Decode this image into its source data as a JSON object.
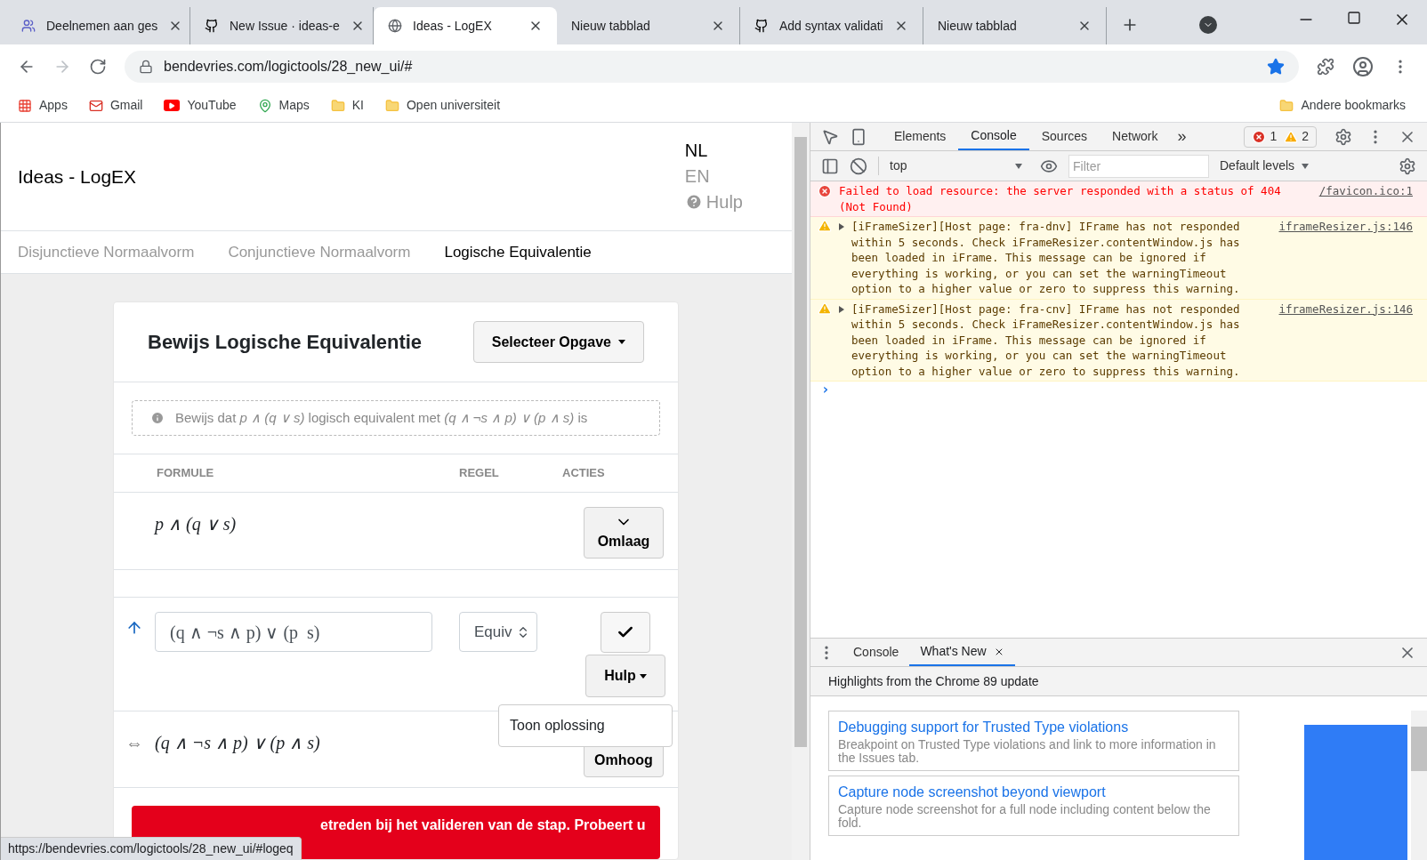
{
  "browser": {
    "tabs": [
      {
        "title": "Deelnemen aan ges",
        "selected": false
      },
      {
        "title": "New Issue · ideas-e",
        "selected": false
      },
      {
        "title": "Ideas - LogEX",
        "selected": true
      },
      {
        "title": "Nieuw tabblad",
        "selected": false
      },
      {
        "title": "Add syntax validati",
        "selected": false
      },
      {
        "title": "Nieuw tabblad",
        "selected": false
      }
    ],
    "url": "bendevries.com/logictools/28_new_ui/#",
    "bookmarks": [
      "Apps",
      "Gmail",
      "YouTube",
      "Maps",
      "KI",
      "Open universiteit"
    ],
    "other_bookmarks": "Andere bookmarks",
    "status_url": "https://bendevries.com/logictools/28_new_ui/#logeq"
  },
  "page": {
    "brand": "Ideas - LogEX",
    "languages": [
      {
        "label": "NL",
        "selected": true
      },
      {
        "label": "EN",
        "selected": false
      }
    ],
    "help": "Hulp",
    "nav": [
      {
        "label": "Disjunctieve Normaalvorm",
        "selected": false
      },
      {
        "label": "Conjunctieve Normaalvorm",
        "selected": false
      },
      {
        "label": "Logische Equivalentie",
        "selected": true
      }
    ],
    "card_title": "Bewijs Logische Equivalentie",
    "select_button": "Selecteer Opgave",
    "problem": "Bewijs dat *p ∧ (q ∨ s)* logisch equivalent met *(q ∧ ¬s ∧ p) ∨ (p ∧ s)* is",
    "columns": [
      "FORMULE",
      "REGEL",
      "ACTIES"
    ],
    "rows": [
      {
        "kind": "formula",
        "formula": "p ∧ (q ∨ s)",
        "button": "Omlaag"
      },
      {
        "kind": "input",
        "value": "(q ∧ ¬s ∧ p) ∨ (p  s)",
        "rule": "Equiv",
        "help_button": "Hulp",
        "menu_item": "Toon oplossing"
      },
      {
        "kind": "formula",
        "prefix": "⇔",
        "formula": "(q ∧ ¬s ∧ p) ∨ (p ∧ s)",
        "button": "Omhoog"
      }
    ],
    "error_banner": "etreden bij het valideren van de stap. Probeert u"
  },
  "devtools": {
    "tabs": [
      {
        "label": "Elements",
        "selected": false
      },
      {
        "label": "Console",
        "selected": true
      },
      {
        "label": "Sources",
        "selected": false
      },
      {
        "label": "Network",
        "selected": false
      }
    ],
    "more": "»",
    "errors": "1",
    "warnings": "2",
    "context": "top",
    "filter_placeholder": "Filter",
    "levels": "Default levels",
    "messages": [
      {
        "kind": "error",
        "text": "Failed to load resource: the server responded with a status of 404 (Not Found)",
        "source": "/favicon.ico:1"
      },
      {
        "kind": "warning",
        "text": "[iFrameSizer][Host page: fra-dnv] IFrame has not responded within 5 seconds. Check iFrameResizer.contentWindow.js has been loaded in iFrame. This message can be ignored if everything is working, or you can set the warningTimeout option to a higher value or zero to suppress this warning.",
        "source": "iframeResizer.js:146"
      },
      {
        "kind": "warning",
        "text": "[iFrameSizer][Host page: fra-cnv] IFrame has not responded within 5 seconds. Check iFrameResizer.contentWindow.js has been loaded in iFrame. This message can be ignored if everything is working, or you can set the warningTimeout option to a higher value or zero to suppress this warning.",
        "source": "iframeResizer.js:146"
      }
    ],
    "prompt": "›",
    "drawer_tabs": [
      {
        "label": "Console",
        "selected": false
      },
      {
        "label": "What's New",
        "selected": true
      }
    ],
    "drawer_header": "Highlights from the Chrome 89 update",
    "news": [
      {
        "title": "Debugging support for Trusted Type violations",
        "description": "Breakpoint on Trusted Type violations and link to more information in the Issues tab."
      },
      {
        "title": "Capture node screenshot beyond viewport",
        "description": "Capture node screenshot for a full node including content below the fold."
      }
    ]
  }
}
